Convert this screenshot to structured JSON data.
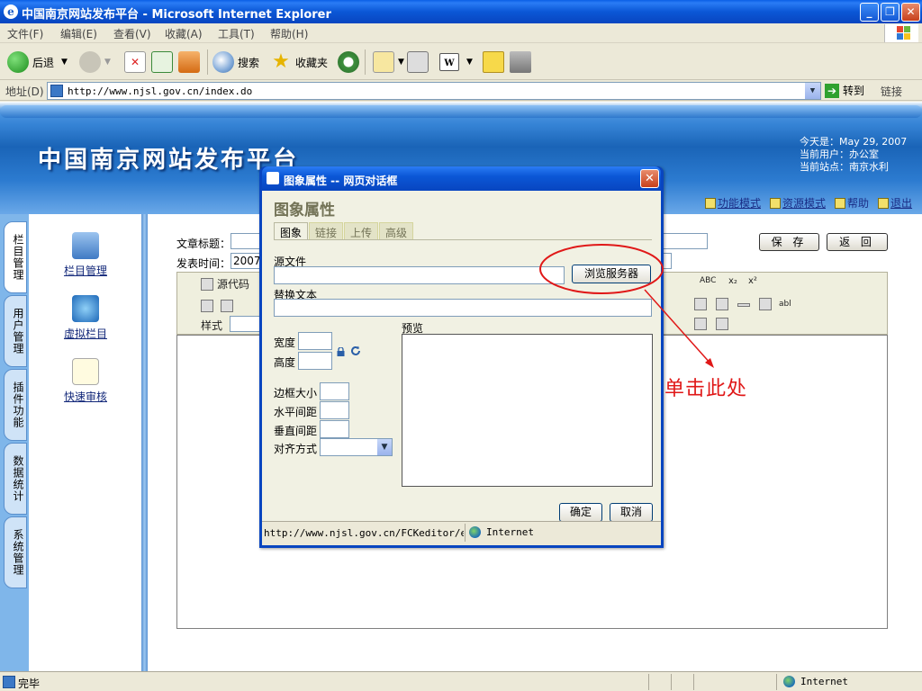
{
  "window": {
    "title": "中国南京网站发布平台 - Microsoft Internet Explorer",
    "controls": [
      "_",
      "❐",
      "✕"
    ]
  },
  "menu": {
    "items": [
      "文件(F)",
      "编辑(E)",
      "查看(V)",
      "收藏(A)",
      "工具(T)",
      "帮助(H)"
    ]
  },
  "toolbar": {
    "back_label": "后退",
    "search_label": "搜索",
    "favorites_label": "收藏夹"
  },
  "address": {
    "label": "地址(D)",
    "url": "http://www.njsl.gov.cn/index.do",
    "go_label": "转到",
    "links_label": "链接"
  },
  "site": {
    "title": "中国南京网站发布平台",
    "date_line": "今天是：May 29, 2007",
    "user_line": "当前用户：办公室",
    "station_line": "当前站点：南京水利",
    "nav": [
      "功能模式",
      "资源模式",
      "帮助",
      "退出"
    ]
  },
  "sidebar": {
    "tabs": [
      "栏目管理",
      "用户管理",
      "插件功能",
      "数据统计",
      "系统管理"
    ],
    "items": [
      "栏目管理",
      "虚拟栏目",
      "快速审核"
    ]
  },
  "article": {
    "title_label": "文章标题：",
    "time_label": "发表时间：",
    "time_value": "2007-",
    "save_label": "保 存",
    "back_label": "返 回",
    "source_label": "源代码",
    "style_label": "样式"
  },
  "dialog": {
    "title": "图象属性 -- 网页对话框",
    "heading": "图象属性",
    "tabs": [
      "图象",
      "链接",
      "上传",
      "高级"
    ],
    "src_label": "源文件",
    "browse_label": "浏览服务器",
    "alt_label": "替换文本",
    "width_label": "宽度",
    "height_label": "高度",
    "border_label": "边框大小",
    "hspace_label": "水平间距",
    "vspace_label": "垂直间距",
    "align_label": "对齐方式",
    "preview_label": "预览",
    "ok_label": "确定",
    "cancel_label": "取消",
    "status_url": "http://www.njsl.gov.cn/FCKeditor/edit",
    "status_zone": "Internet"
  },
  "annotation": {
    "text": "单击此处",
    "color": "#e01818"
  },
  "status": {
    "text": "完毕",
    "zone": "Internet"
  }
}
